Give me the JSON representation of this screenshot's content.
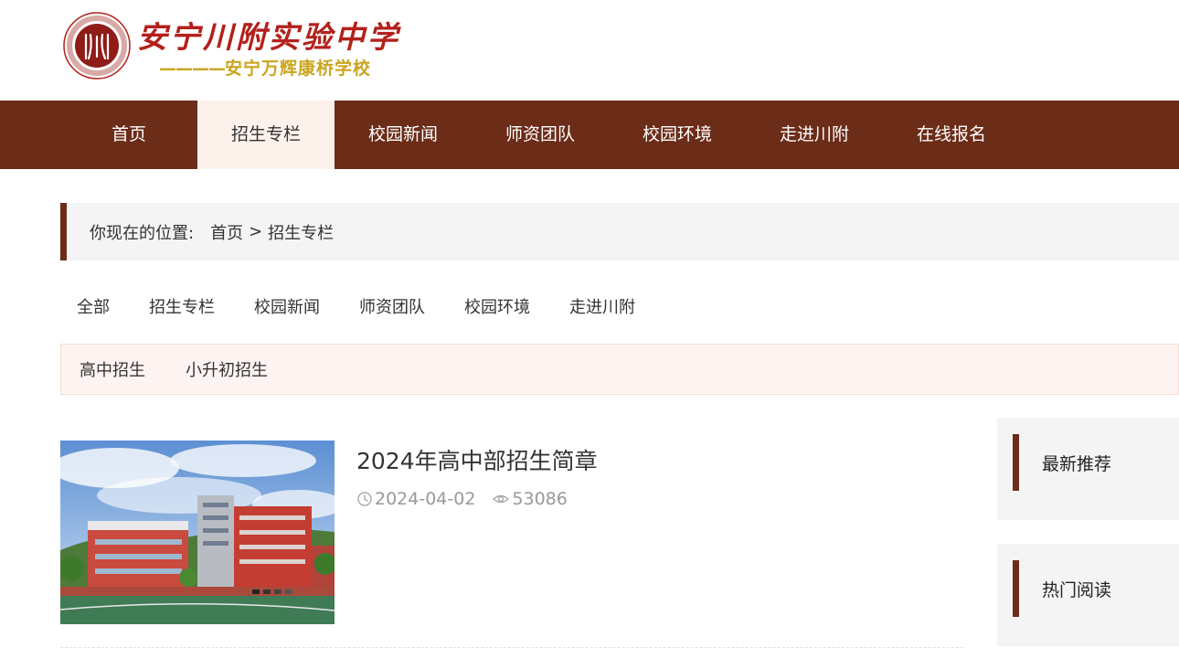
{
  "header": {
    "logo_title": "安宁川附实验中学",
    "logo_subtitle_dashes": "————",
    "logo_subtitle": "安宁万辉康桥学校",
    "seal_text": "川附"
  },
  "nav": {
    "items": [
      {
        "label": "首页"
      },
      {
        "label": "招生专栏"
      },
      {
        "label": "校园新闻"
      },
      {
        "label": "师资团队"
      },
      {
        "label": "校园环境"
      },
      {
        "label": "走进川附"
      },
      {
        "label": "在线报名"
      }
    ],
    "active_index": 1
  },
  "breadcrumb": {
    "label": "你现在的位置:",
    "home": "首页",
    "separator": ">",
    "current": "招生专栏"
  },
  "categories": [
    "全部",
    "招生专栏",
    "校园新闻",
    "师资团队",
    "校园环境",
    "走进川附"
  ],
  "subcategories": [
    "高中招生",
    "小升初招生"
  ],
  "articles": [
    {
      "title": "2024年高中部招生简章",
      "date": "2024-04-02",
      "views": "53086"
    }
  ],
  "sidebar": {
    "latest_title": "最新推荐",
    "hot_title": "热门阅读"
  },
  "colors": {
    "brand": "#6b2c18",
    "active_tab_bg": "#fdf1ec",
    "logo_red": "#b3201b",
    "logo_gold": "#c9a520"
  }
}
